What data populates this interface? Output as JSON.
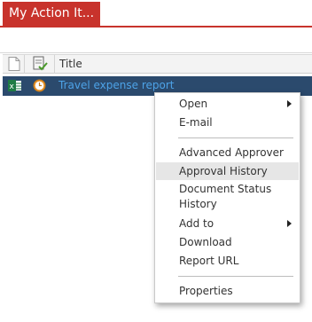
{
  "app": {
    "title": "My Action It..."
  },
  "list": {
    "header": {
      "title_column": "Title"
    },
    "rows": [
      {
        "title": "Travel expense report"
      }
    ]
  },
  "context_menu": {
    "items": [
      {
        "label": "Open",
        "submenu": true
      },
      {
        "label": "E-mail"
      },
      {
        "label": "Advanced Approver"
      },
      {
        "label": "Approval History"
      },
      {
        "label": "Document Status History"
      },
      {
        "label": "Add to",
        "submenu": true
      },
      {
        "label": "Download"
      },
      {
        "label": "Report URL"
      },
      {
        "label": "Properties"
      }
    ],
    "highlighted": "Approval History"
  },
  "colors": {
    "accent_red": "#c8332c",
    "selected_row": "#2b4a6d",
    "link_blue": "#4da3e8",
    "menu_highlight": "#e6e6e6"
  },
  "icons": {
    "doc_column": "document-icon",
    "wf_column": "workflow-icon",
    "row_type": "excel-icon",
    "row_status": "clock-icon"
  }
}
